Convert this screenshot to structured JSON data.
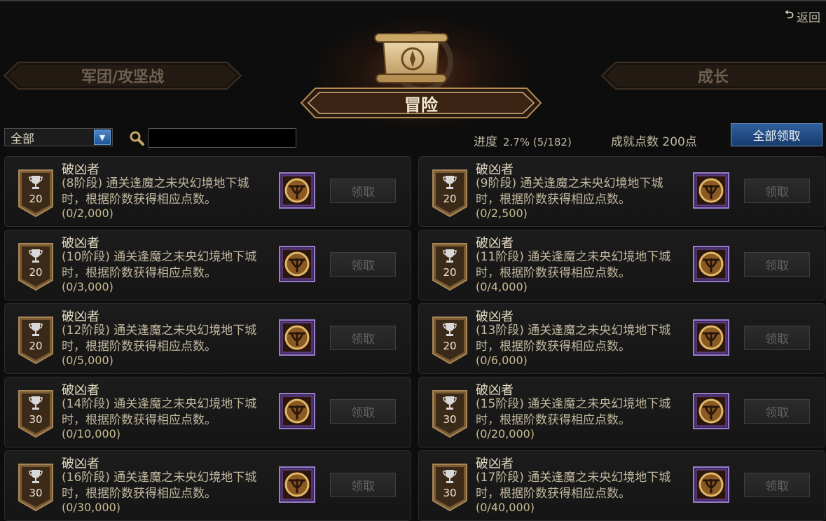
{
  "header": {
    "back_label": "返回",
    "tab_left": "军团/攻坚战",
    "tab_active": "冒险",
    "tab_right": "成长"
  },
  "filter": {
    "category_value": "全部",
    "search_placeholder": "",
    "progress_label": "进度",
    "progress_value": "2.7% (5/182)",
    "points_label": "成就点数 200点",
    "claim_all_label": "全部领取"
  },
  "achievements": [
    {
      "title": "破凶者",
      "desc": "(8阶段) 通关逢魔之未央幻境地下城时，根据阶数获得相应点数。",
      "progress": "(0/2,000)",
      "points": "20",
      "claim_label": "领取"
    },
    {
      "title": "破凶者",
      "desc": "(9阶段) 通关逢魔之未央幻境地下城时，根据阶数获得相应点数。",
      "progress": "(0/2,500)",
      "points": "20",
      "claim_label": "领取"
    },
    {
      "title": "破凶者",
      "desc": "(10阶段) 通关逢魔之未央幻境地下城时，根据阶数获得相应点数。",
      "progress": "(0/3,000)",
      "points": "20",
      "claim_label": "领取"
    },
    {
      "title": "破凶者",
      "desc": "(11阶段) 通关逢魔之未央幻境地下城时，根据阶数获得相应点数。",
      "progress": "(0/4,000)",
      "points": "20",
      "claim_label": "领取"
    },
    {
      "title": "破凶者",
      "desc": "(12阶段) 通关逢魔之未央幻境地下城时，根据阶数获得相应点数。",
      "progress": "(0/5,000)",
      "points": "20",
      "claim_label": "领取"
    },
    {
      "title": "破凶者",
      "desc": "(13阶段) 通关逢魔之未央幻境地下城时，根据阶数获得相应点数。",
      "progress": "(0/6,000)",
      "points": "20",
      "claim_label": "领取"
    },
    {
      "title": "破凶者",
      "desc": "(14阶段) 通关逢魔之未央幻境地下城时，根据阶数获得相应点数。",
      "progress": "(0/10,000)",
      "points": "30",
      "claim_label": "领取"
    },
    {
      "title": "破凶者",
      "desc": "(15阶段) 通关逢魔之未央幻境地下城时，根据阶数获得相应点数。",
      "progress": "(0/20,000)",
      "points": "30",
      "claim_label": "领取"
    },
    {
      "title": "破凶者",
      "desc": "(16阶段) 通关逢魔之未央幻境地下城时，根据阶数获得相应点数。",
      "progress": "(0/30,000)",
      "points": "30",
      "claim_label": "领取"
    },
    {
      "title": "破凶者",
      "desc": "(17阶段) 通关逢魔之未央幻境地下城时，根据阶数获得相应点数。",
      "progress": "(0/40,000)",
      "points": "30",
      "claim_label": "领取"
    }
  ],
  "icons": {
    "back": "return-arrow-icon",
    "search": "search-icon",
    "dropdown": "chevron-down-icon",
    "trophy": "trophy-icon",
    "badge": "achievement-emblem-icon",
    "scroll": "scroll-compass-icon"
  },
  "colors": {
    "accent_gold": "#c9a45a",
    "claim_all_blue": "#2e5f9e",
    "badge_purple": "#7a4fb3"
  }
}
